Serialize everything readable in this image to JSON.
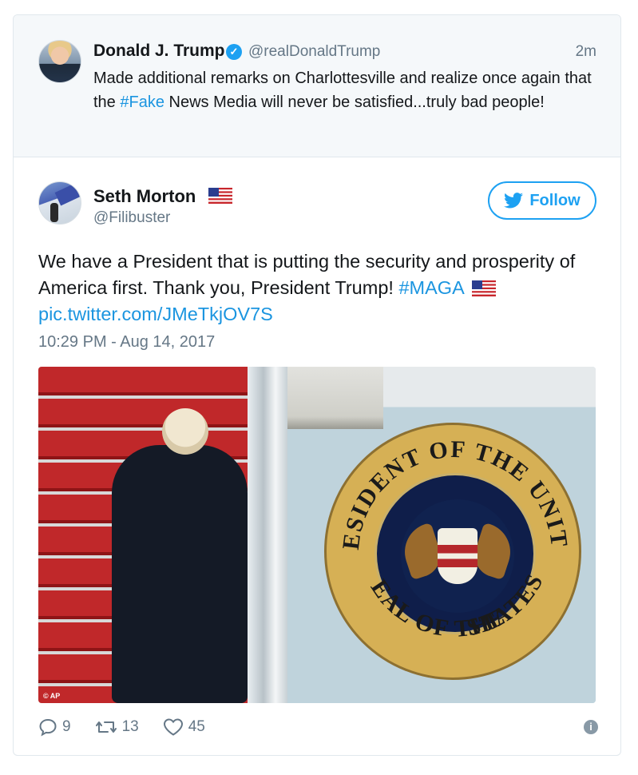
{
  "parent_tweet": {
    "name": "Donald J. Trump",
    "handle": "@realDonaldTrump",
    "time": "2m",
    "text_before": "Made additional remarks on Charlottesville and realize once again that the ",
    "hashtag": "#Fake",
    "text_after": " News Media will never be satisfied...truly bad people!"
  },
  "main_tweet": {
    "name": "Seth Morton",
    "handle": "@Filibuster",
    "follow_label": "Follow",
    "text": "We have a President that is putting the security and prosperity of America first. Thank you, President Trump! ",
    "hashtag": "#MAGA",
    "link": "pic.twitter.com/JMeTkjOV7S",
    "timestamp": "10:29 PM - Aug 14, 2017",
    "photo_credit": "© AP",
    "seal_text_top": "PRESIDENT OF THE UNITED",
    "seal_text_bottom": "SEAL OF THE",
    "seal_text_right": "STATES"
  },
  "actions": {
    "replies": "9",
    "retweets": "13",
    "likes": "45"
  },
  "icons": {
    "verified": "verified-badge-icon",
    "flag": "us-flag-icon",
    "follow": "twitter-bird-icon",
    "reply": "reply-icon",
    "retweet": "retweet-icon",
    "like": "heart-icon",
    "info": "info-icon"
  },
  "colors": {
    "accent": "#1da1f2",
    "link": "#1b95e0",
    "muted": "#657786",
    "parent_bg": "#f5f8fa"
  }
}
